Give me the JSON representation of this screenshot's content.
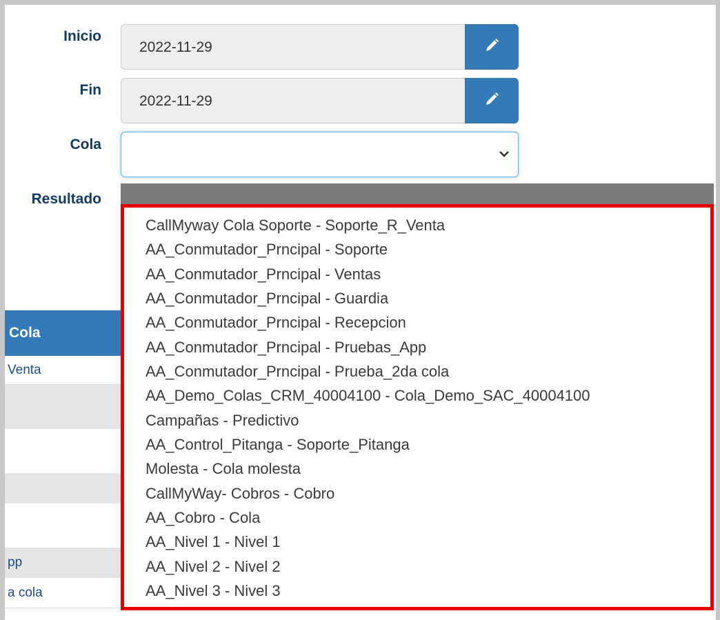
{
  "form": {
    "inicio_label": "Inicio",
    "inicio_value": "2022-11-29",
    "fin_label": "Fin",
    "fin_value": "2022-11-29",
    "cola_label": "Cola",
    "cola_value": "",
    "resultado_label": "Resultado"
  },
  "icons": {
    "edit": "pencil-icon",
    "select": "chevron-down-icon"
  },
  "colors": {
    "primary": "#337ab7",
    "label": "#123a64",
    "highlight": "#e60000"
  },
  "table": {
    "header": "Cola",
    "rows": [
      "Venta",
      "",
      "",
      "",
      "",
      "pp",
      "a cola"
    ]
  },
  "dropdown": {
    "options": [
      "CallMyway Cola Soporte - Soporte_R_Venta",
      "AA_Conmutador_Prncipal - Soporte",
      "AA_Conmutador_Prncipal - Ventas",
      "AA_Conmutador_Prncipal - Guardia",
      "AA_Conmutador_Prncipal - Recepcion",
      "AA_Conmutador_Prncipal - Pruebas_App",
      "AA_Conmutador_Prncipal - Prueba_2da cola",
      "AA_Demo_Colas_CRM_40004100 - Cola_Demo_SAC_40004100",
      "Campañas - Predictivo",
      "AA_Control_Pitanga - Soporte_Pitanga",
      "Molesta - Cola molesta",
      "CallMyWay- Cobros - Cobro",
      "AA_Cobro - Cola",
      "AA_Nivel 1 - Nivel 1",
      "AA_Nivel 2 - Nivel 2",
      "AA_Nivel 3 - Nivel 3"
    ]
  }
}
